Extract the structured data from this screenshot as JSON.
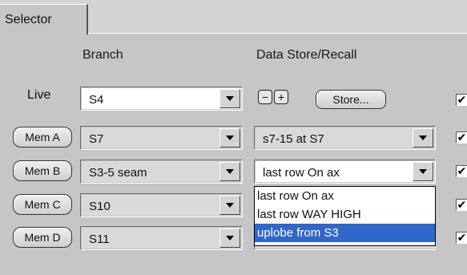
{
  "tab": {
    "label": "Selector"
  },
  "headers": {
    "branch": "Branch",
    "data_store": "Data Store/Recall"
  },
  "live": {
    "label": "Live",
    "branch": "S4",
    "minus": "−",
    "plus": "+",
    "store_button": "Store...",
    "checked": true
  },
  "rows": [
    {
      "mem_button": "Mem A",
      "branch": "S7",
      "recall": "s7-15 at S7",
      "checked": true
    },
    {
      "mem_button": "Mem B",
      "branch": "S3-5 seam",
      "recall": "last row On ax",
      "checked": true
    },
    {
      "mem_button": "Mem C",
      "branch": "S10",
      "recall": "",
      "checked": true
    },
    {
      "mem_button": "Mem D",
      "branch": "S11",
      "recall": "",
      "checked": true
    }
  ],
  "dropdown": {
    "items": [
      "last row On ax",
      "last row WAY HIGH",
      "uplobe from S3"
    ],
    "selected_index": 2
  },
  "check_glyph": "✔"
}
